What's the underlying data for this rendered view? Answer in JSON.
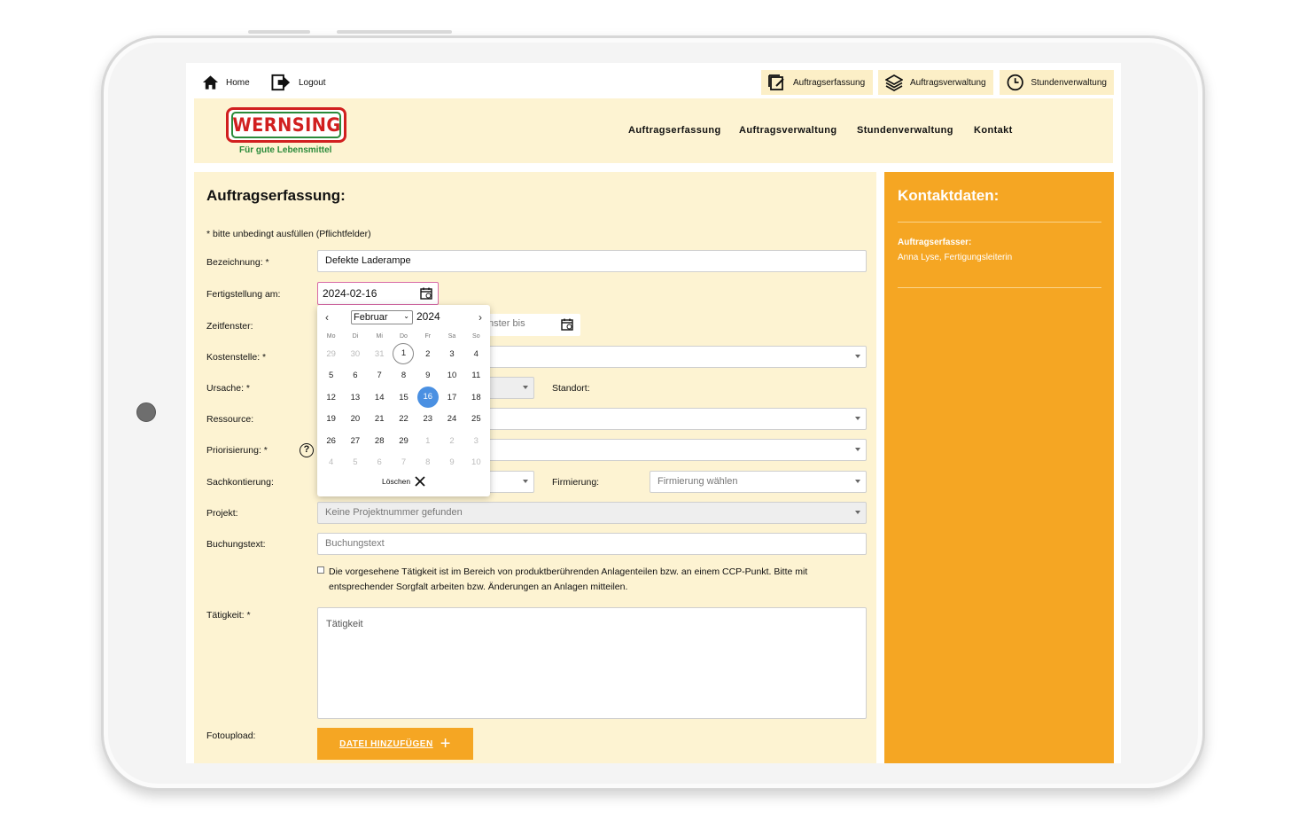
{
  "topbar": {
    "home_label": "Home",
    "logout_label": "Logout",
    "quick_links": [
      "Auftragserfassung",
      "Auftragsverwaltung",
      "Stundenverwaltung"
    ]
  },
  "brand": {
    "logo_text": "WERNSING",
    "tagline": "Für gute Lebensmittel",
    "colors": {
      "red": "#d11f1f",
      "green": "#2a8a3a"
    }
  },
  "main_nav": [
    "Auftragserfassung",
    "Auftragsverwaltung",
    "Stundenverwaltung",
    "Kontakt"
  ],
  "form": {
    "title": "Auftragserfassung:",
    "hint": "* bitte unbedingt ausfüllen (Pflichtfelder)",
    "labels": {
      "bezeichnung": "Bezeichnung: *",
      "fertigstellung": "Fertigstellung am:",
      "zeitfenster": "Zeitfenster:",
      "kostenstelle": "Kostenstelle: *",
      "ursache": "Ursache: *",
      "standort": "Standort:",
      "ressource": "Ressource:",
      "priorisierung": "Priorisierung: *",
      "sachkontierung": "Sachkontierung:",
      "firmierung": "Firmierung:",
      "projekt": "Projekt:",
      "buchungstext": "Buchungstext:",
      "taetigkeit": "Tätigkeit: *",
      "fotoupload": "Fotoupload:"
    },
    "values": {
      "bezeichnung": "Defekte Laderampe",
      "fertigstellung": "2024-02-16",
      "zeitfenster_bis_partial": "nster bis"
    },
    "placeholders": {
      "firmierung": "Firmierung wählen",
      "projekt": "Keine Projektnummer gefunden",
      "buchungstext": "Buchungstext",
      "taetigkeit": "Tätigkeit"
    },
    "help_icon": "?",
    "checkbox_text": "Die vorgesehene Tätigkeit ist im Bereich von produktberührenden Anlagenteilen bzw. an einem CCP-Punkt. Bitte mit entsprechender Sorgfalt arbeiten bzw. Änderungen an Anlagen mitteilen.",
    "upload_label": "DATEI HINZUFÜGEN",
    "upload_plus": "+"
  },
  "calendar": {
    "prev": "‹",
    "next": "›",
    "month": "Februar",
    "year": "2024",
    "weekdays": [
      "Mo",
      "Di",
      "Mi",
      "Do",
      "Fr",
      "Sa",
      "So"
    ],
    "weeks": [
      [
        "29",
        "30",
        "31",
        "1",
        "2",
        "3",
        "4"
      ],
      [
        "5",
        "6",
        "7",
        "8",
        "9",
        "10",
        "11"
      ],
      [
        "12",
        "13",
        "14",
        "15",
        "16",
        "17",
        "18"
      ],
      [
        "19",
        "20",
        "21",
        "22",
        "23",
        "24",
        "25"
      ],
      [
        "26",
        "27",
        "28",
        "29",
        "1",
        "2",
        "3"
      ],
      [
        "4",
        "5",
        "6",
        "7",
        "8",
        "9",
        "10"
      ]
    ],
    "today": "1",
    "selected": "16",
    "clear_label": "Löschen"
  },
  "sidebar": {
    "title": "Kontaktdaten:",
    "key": "Auftragserfasser:",
    "value": "Anna Lyse, Fertigungsleiterin",
    "accent": "#f5a623"
  }
}
